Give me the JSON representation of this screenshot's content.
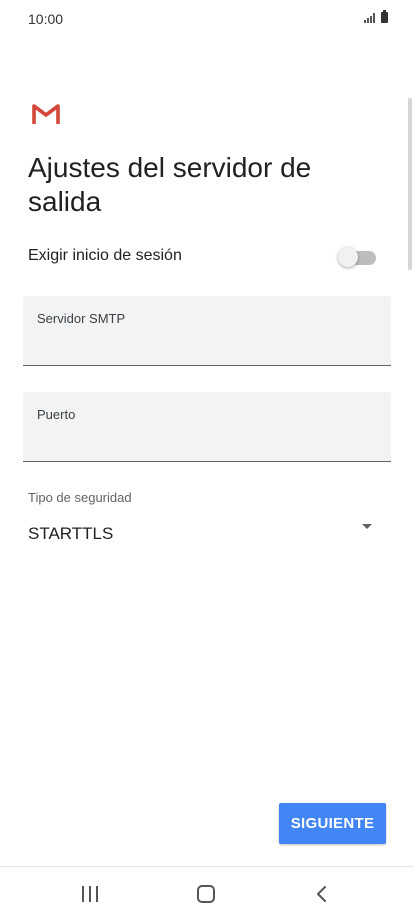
{
  "status_bar": {
    "time": "10:00",
    "icons": [
      "signal-icon",
      "battery-icon"
    ]
  },
  "header": {
    "logo_icon": "gmail-logo",
    "title": "Ajustes del servidor de salida"
  },
  "form": {
    "require_login": {
      "label": "Exigir inicio de sesión",
      "enabled": false
    },
    "smtp_server": {
      "label": "Servidor SMTP",
      "value": ""
    },
    "port": {
      "label": "Puerto",
      "value": ""
    },
    "security_type": {
      "label": "Tipo de seguridad",
      "selected": "STARTTLS"
    }
  },
  "actions": {
    "next_label": "SIGUIENTE"
  },
  "nav_bar": {
    "icons": [
      "recent-apps-icon",
      "home-icon",
      "back-icon"
    ]
  },
  "colors": {
    "accent": "#4285f4",
    "gmail_red": "#d44638",
    "field_background": "#f1f3f4"
  }
}
